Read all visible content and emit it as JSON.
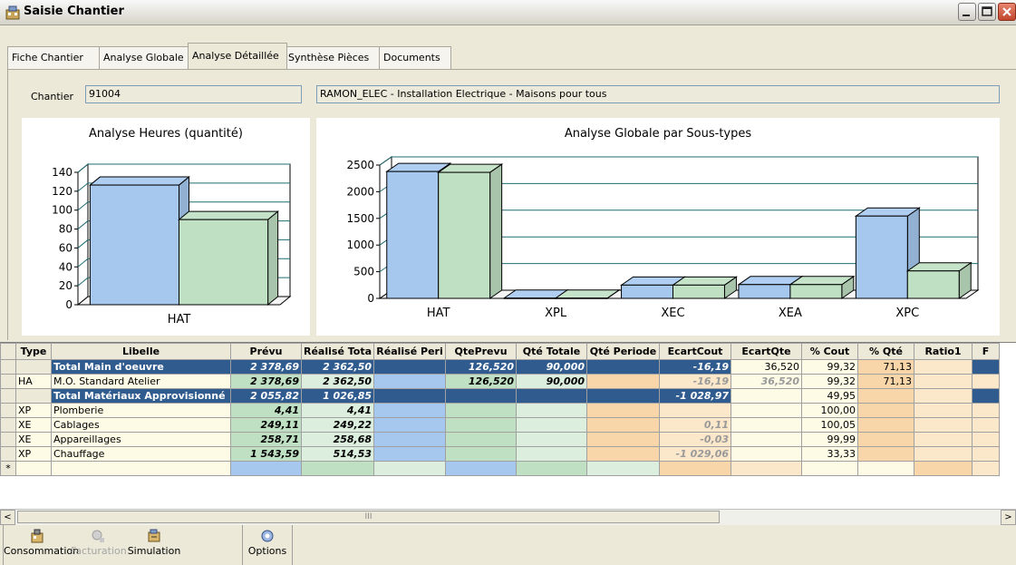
{
  "window": {
    "title": "Saisie Chantier"
  },
  "tabs": [
    {
      "label": "Fiche Chantier"
    },
    {
      "label": "Analyse Globale"
    },
    {
      "label": "Analyse Détaillée"
    },
    {
      "label": "Synthèse Pièces"
    },
    {
      "label": "Documents"
    }
  ],
  "active_tab": "Analyse Détaillée",
  "chantier": {
    "label": "Chantier",
    "code": "91004",
    "description": "RAMON_ELEC - Installation Electrique - Maisons pour tous"
  },
  "chart_data": [
    {
      "type": "bar",
      "title": "Analyse Heures (quantité)",
      "categories": [
        "HAT"
      ],
      "series": [
        {
          "values": [
            126.52
          ],
          "color": "#a6c8ef"
        },
        {
          "values": [
            90.0
          ],
          "color": "#bfe0c3"
        }
      ],
      "ylim": [
        0,
        140
      ],
      "yticks": [
        0,
        20,
        40,
        60,
        80,
        100,
        120,
        140
      ],
      "grid": true
    },
    {
      "type": "bar",
      "title": "Analyse Globale par Sous-types",
      "categories": [
        "HAT",
        "XPL",
        "XEC",
        "XEA",
        "XPC"
      ],
      "series": [
        {
          "values": [
            2378.69,
            4.41,
            249.11,
            258.71,
            1543.59
          ],
          "color": "#a6c8ef"
        },
        {
          "values": [
            2362.5,
            4.41,
            249.22,
            258.68,
            514.53
          ],
          "color": "#bfe0c3"
        }
      ],
      "ylim": [
        0,
        2500
      ],
      "yticks": [
        0,
        500,
        1000,
        1500,
        2000,
        2500
      ],
      "grid": true
    }
  ],
  "grid": {
    "columns": [
      "Type",
      "Libelle",
      "Prévu",
      "Réalisé Tota",
      "Réalisé Peri",
      "QtePrevu",
      "Qté Totale",
      "Qté Periode",
      "EcartCout",
      "EcartQte",
      "% Cout",
      "% Qté",
      "Ratio1",
      "F"
    ],
    "rows": [
      {
        "type": "",
        "libelle": "Total Main d'oeuvre",
        "prevu": "2 378,69",
        "realise_total": "2 362,50",
        "realise_periode": "",
        "qte_prevu": "126,520",
        "qte_totale": "90,000",
        "qte_periode": "",
        "ecart_cout": "-16,19",
        "ecart_qte": "36,520",
        "pct_cout": "99,32",
        "pct_qte": "71,13",
        "ratio1": "",
        "total": true
      },
      {
        "type": "HA",
        "libelle": "M.O. Standard Atelier",
        "prevu": "2 378,69",
        "realise_total": "2 362,50",
        "realise_periode": "",
        "qte_prevu": "126,520",
        "qte_totale": "90,000",
        "qte_periode": "",
        "ecart_cout": "-16,19",
        "ecart_qte": "36,520",
        "pct_cout": "99,32",
        "pct_qte": "71,13",
        "ratio1": "",
        "total": false
      },
      {
        "type": "",
        "libelle": "Total Matériaux Approvisionné",
        "prevu": "2 055,82",
        "realise_total": "1 026,85",
        "realise_periode": "",
        "qte_prevu": "",
        "qte_totale": "",
        "qte_periode": "",
        "ecart_cout": "-1 028,97",
        "ecart_qte": "",
        "pct_cout": "49,95",
        "pct_qte": "",
        "ratio1": "",
        "total": true
      },
      {
        "type": "XP",
        "libelle": "Plomberie",
        "prevu": "4,41",
        "realise_total": "4,41",
        "realise_periode": "",
        "qte_prevu": "",
        "qte_totale": "",
        "qte_periode": "",
        "ecart_cout": "",
        "ecart_qte": "",
        "pct_cout": "100,00",
        "pct_qte": "",
        "ratio1": "",
        "total": false
      },
      {
        "type": "XE",
        "libelle": "Cablages",
        "prevu": "249,11",
        "realise_total": "249,22",
        "realise_periode": "",
        "qte_prevu": "",
        "qte_totale": "",
        "qte_periode": "",
        "ecart_cout": "0,11",
        "ecart_qte": "",
        "pct_cout": "100,05",
        "pct_qte": "",
        "ratio1": "",
        "total": false
      },
      {
        "type": "XE",
        "libelle": "Appareillages",
        "prevu": "258,71",
        "realise_total": "258,68",
        "realise_periode": "",
        "qte_prevu": "",
        "qte_totale": "",
        "qte_periode": "",
        "ecart_cout": "-0,03",
        "ecart_qte": "",
        "pct_cout": "99,99",
        "pct_qte": "",
        "ratio1": "",
        "total": false
      },
      {
        "type": "XP",
        "libelle": "Chauffage",
        "prevu": "1 543,59",
        "realise_total": "514,53",
        "realise_periode": "",
        "qte_prevu": "",
        "qte_totale": "",
        "qte_periode": "",
        "ecart_cout": "-1 029,06",
        "ecart_qte": "",
        "pct_cout": "33,33",
        "pct_qte": "",
        "ratio1": "",
        "total": false
      }
    ],
    "new_row_marker": "*"
  },
  "scrollbar": {
    "thumb_glyph": "III",
    "left_arrow": "<",
    "right_arrow": ">"
  },
  "toolbar": [
    {
      "label": "Consommation",
      "icon": "consumption-icon",
      "enabled": true
    },
    {
      "label": "Facturation",
      "icon": "invoice-icon",
      "enabled": false
    },
    {
      "label": "Simulation",
      "icon": "simulation-icon",
      "enabled": true
    },
    {
      "label": "Options",
      "icon": "options-icon",
      "enabled": true
    }
  ]
}
